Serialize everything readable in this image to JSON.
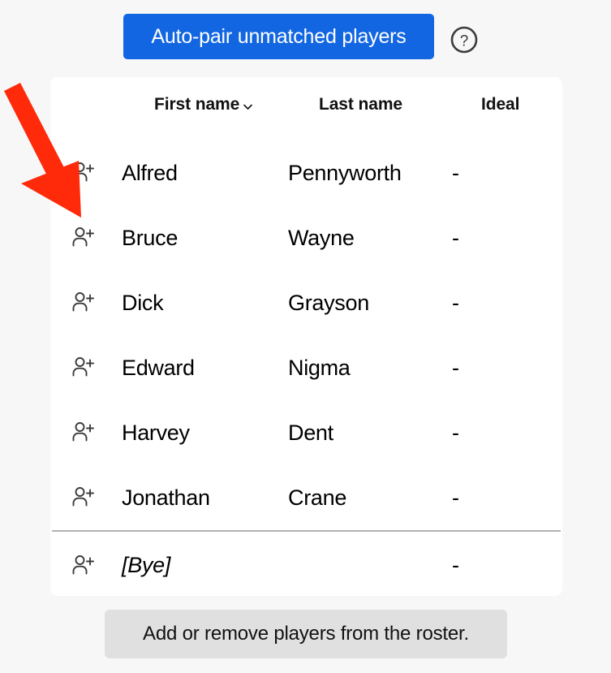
{
  "toolbar": {
    "autopair_label": "Auto-pair unmatched players",
    "help_icon": "help-circle-icon",
    "accent_color": "#1266e2"
  },
  "table": {
    "columns": [
      {
        "key": "first",
        "label": "First name",
        "sort_icon": "chevron-down-icon",
        "sortable": true
      },
      {
        "key": "last",
        "label": "Last name",
        "sortable": false
      },
      {
        "key": "ideal",
        "label": "Ideal",
        "sortable": false
      }
    ],
    "row_action_icon": "person-add-icon",
    "rows": [
      {
        "first": "Alfred",
        "last": "Pennyworth",
        "ideal": "-"
      },
      {
        "first": "Bruce",
        "last": "Wayne",
        "ideal": "-"
      },
      {
        "first": "Dick",
        "last": "Grayson",
        "ideal": "-"
      },
      {
        "first": "Edward",
        "last": "Nigma",
        "ideal": "-"
      },
      {
        "first": "Harvey",
        "last": "Dent",
        "ideal": "-"
      },
      {
        "first": "Jonathan",
        "last": "Crane",
        "ideal": "-"
      }
    ],
    "bye_row": {
      "first": "[Bye]",
      "last": "",
      "ideal": "-"
    }
  },
  "footer": {
    "roster_hint_label": "Add or remove players from the roster."
  },
  "annotation": {
    "arrow_color": "#ff2a0a",
    "points_to": "person-add-icon of first player row"
  }
}
